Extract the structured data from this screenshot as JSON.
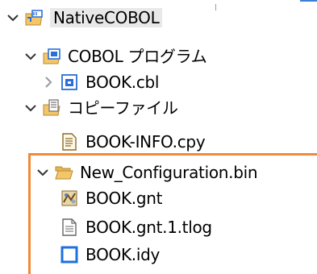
{
  "tree": {
    "project": {
      "label": "NativeCOBOL",
      "icon": "cobol-project-icon",
      "expanded": true
    },
    "cobol_programs": {
      "label": "COBOL プログラム",
      "icon": "program-folder-icon",
      "expanded": true
    },
    "book_cbl": {
      "label": "BOOK.cbl",
      "icon": "cobol-source-icon",
      "expanded": false
    },
    "copybooks": {
      "label": "コピーファイル",
      "icon": "copybook-folder-icon",
      "expanded": true
    },
    "book_info_cpy": {
      "label": "BOOK-INFO.cpy",
      "icon": "copybook-file-icon"
    },
    "config_folder": {
      "label": "New_Configuration.bin",
      "icon": "folder-icon",
      "expanded": true
    },
    "book_gnt": {
      "label": "BOOK.gnt",
      "icon": "gnt-file-icon"
    },
    "book_gnt_tlog": {
      "label": "BOOK.gnt.1.tlog",
      "icon": "text-file-icon"
    },
    "book_idy": {
      "label": "BOOK.idy",
      "icon": "idy-file-icon"
    }
  },
  "colors": {
    "highlight_border": "#f08a39",
    "folder": "#f3c66b",
    "cobol_blue": "#2a6fd6"
  }
}
